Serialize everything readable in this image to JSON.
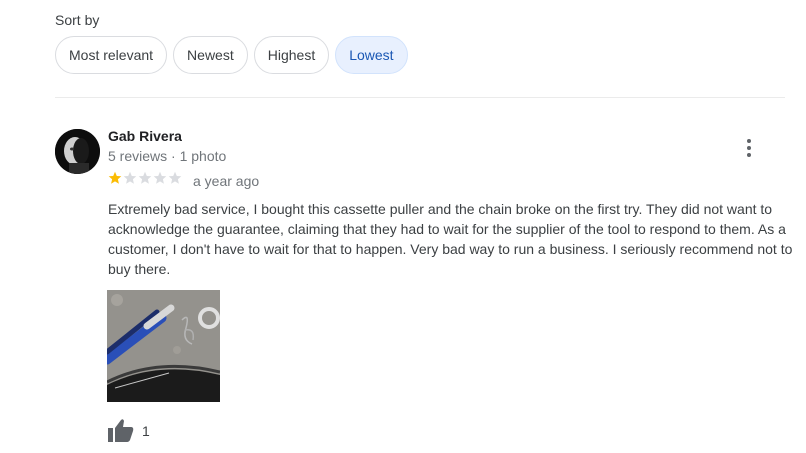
{
  "sort": {
    "label": "Sort by",
    "options": [
      "Most relevant",
      "Newest",
      "Highest",
      "Lowest"
    ],
    "selected": "Lowest"
  },
  "review": {
    "reviewer_name": "Gab Rivera",
    "reviewer_meta": "5 reviews · 1 photo",
    "rating": 1,
    "rating_max": 5,
    "time": "a year ago",
    "text": "Extremely bad service, I bought this cassette puller and the chain broke on the first try. They did not want to acknowledge the guarantee, claiming that they had to wait for the supplier of the tool to respond to them. As a customer, I don't have to wait for that to happen. Very bad way to run a business. I seriously recommend not to buy there.",
    "like_count": "1"
  },
  "colors": {
    "star_filled": "#fbbc04",
    "star_empty": "#dadce0",
    "chip_selected_bg": "#e8f0fe",
    "chip_selected_text": "#1a57b4"
  },
  "icons": {
    "more": "more-vert-icon",
    "like": "thumb-up-icon"
  }
}
